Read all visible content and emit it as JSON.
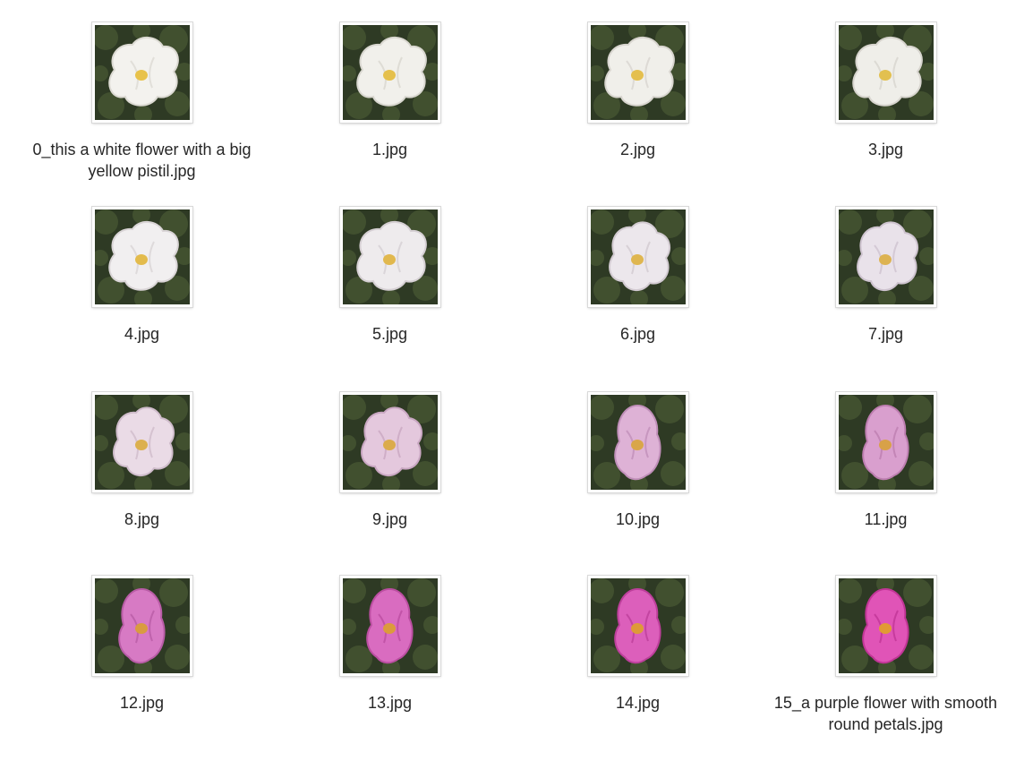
{
  "files": [
    {
      "name": "0_this a white flower with a big yellow pistil.jpg",
      "petal": "#f3f2ee",
      "shade": "#dcdad3",
      "center": "#e8c24a",
      "shape": "wide"
    },
    {
      "name": "1.jpg",
      "petal": "#f1f0eb",
      "shade": "#d9d7d0",
      "center": "#e5c04c",
      "shape": "wide"
    },
    {
      "name": "2.jpg",
      "petal": "#f0efea",
      "shade": "#d8d5cf",
      "center": "#e4bf4e",
      "shape": "wide"
    },
    {
      "name": "3.jpg",
      "petal": "#efeee9",
      "shade": "#d7d4ce",
      "center": "#e2c050",
      "shape": "wide"
    },
    {
      "name": "4.jpg",
      "petal": "#f1eff0",
      "shade": "#d9d4d6",
      "center": "#e3bb4c",
      "shape": "wide"
    },
    {
      "name": "5.jpg",
      "petal": "#eeebed",
      "shade": "#d5cfd3",
      "center": "#e1b84e",
      "shape": "wide"
    },
    {
      "name": "6.jpg",
      "petal": "#ece7ec",
      "shade": "#d2cad1",
      "center": "#dfb650",
      "shape": "mid"
    },
    {
      "name": "7.jpg",
      "petal": "#e9e2ea",
      "shade": "#cec3cf",
      "center": "#ddb352",
      "shape": "mid"
    },
    {
      "name": "8.jpg",
      "petal": "#eadbe6",
      "shade": "#cfbccb",
      "center": "#dcb04e",
      "shape": "mid"
    },
    {
      "name": "9.jpg",
      "petal": "#e4c8dd",
      "shade": "#c9a7c2",
      "center": "#dbab4c",
      "shape": "mid"
    },
    {
      "name": "10.jpg",
      "petal": "#deb2d6",
      "shade": "#c08fb9",
      "center": "#d9a64a",
      "shape": "tall"
    },
    {
      "name": "11.jpg",
      "petal": "#d99fce",
      "shade": "#bd7eb0",
      "center": "#d8a148",
      "shape": "tall"
    },
    {
      "name": "12.jpg",
      "petal": "#d77ac4",
      "shade": "#b95ca6",
      "center": "#d99b40",
      "shape": "tall"
    },
    {
      "name": "13.jpg",
      "petal": "#d96cc0",
      "shade": "#bb4ea1",
      "center": "#dc9b3c",
      "shape": "tall"
    },
    {
      "name": "14.jpg",
      "petal": "#dc5fbb",
      "shade": "#bd3f9b",
      "center": "#de9a38",
      "shape": "tall"
    },
    {
      "name": "15_a purple flower with smooth round petals.jpg",
      "petal": "#e054b7",
      "shade": "#c13596",
      "center": "#e19a34",
      "shape": "tall"
    }
  ],
  "icons": {
    "thumbnail": "flower-photo-icon"
  },
  "colors": {
    "background": "#ffffff",
    "label_text": "#262626",
    "foliage_dark": "#2e3a24",
    "foliage_mid": "#4a5a34"
  }
}
